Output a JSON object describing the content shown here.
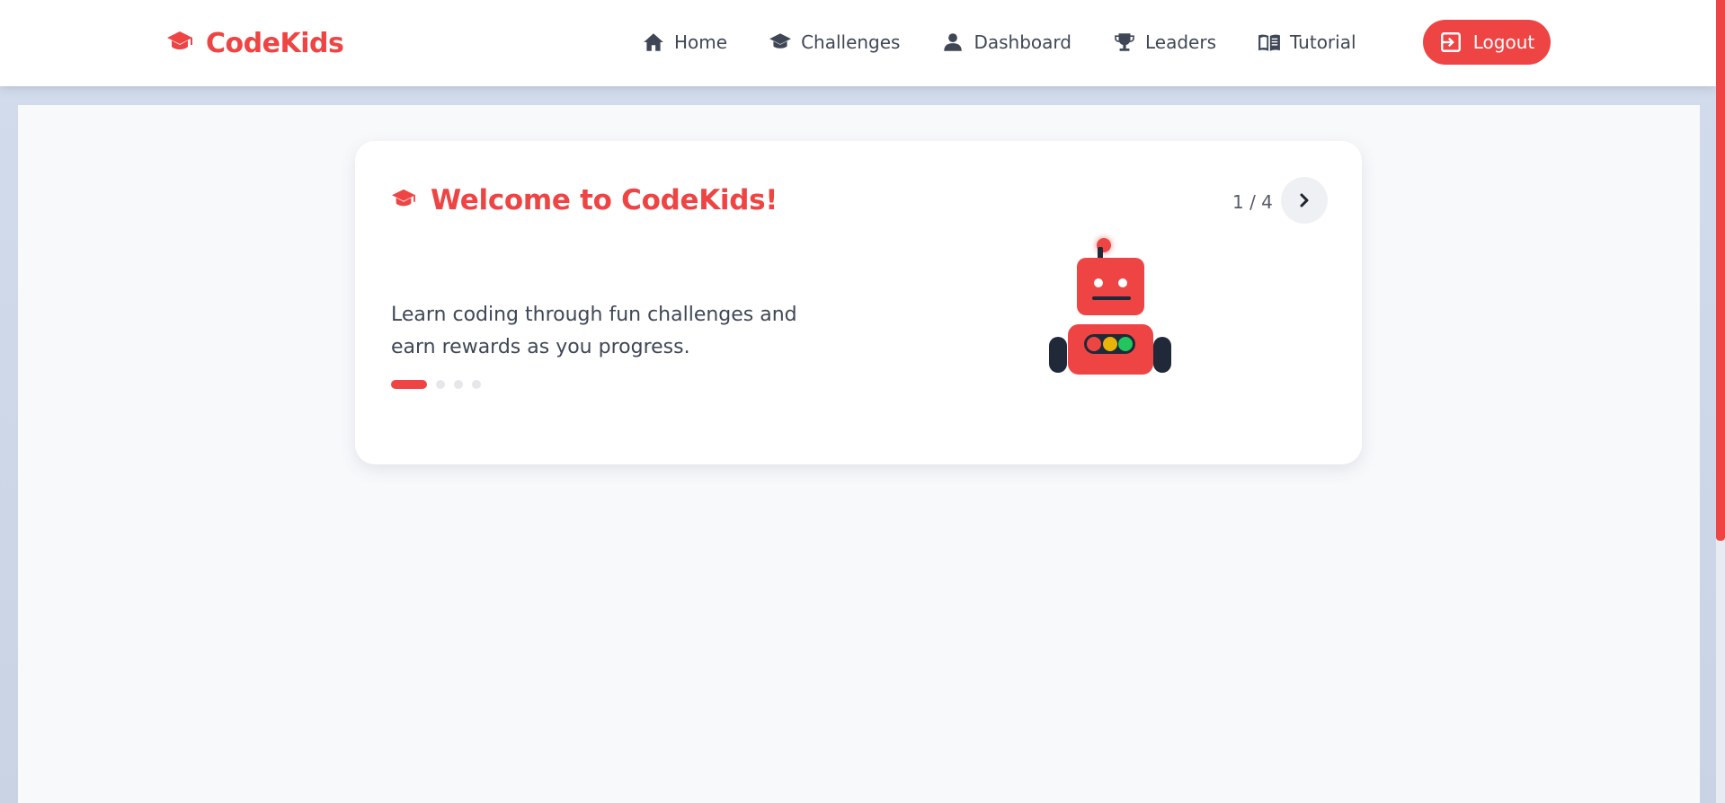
{
  "brand": {
    "name": "CodeKids",
    "icon": "graduation-cap-icon",
    "color": "#ef4444"
  },
  "nav": {
    "items": [
      {
        "label": "Home",
        "icon": "home-icon"
      },
      {
        "label": "Challenges",
        "icon": "graduation-cap-icon"
      },
      {
        "label": "Dashboard",
        "icon": "user-icon"
      },
      {
        "label": "Leaders",
        "icon": "trophy-icon"
      },
      {
        "label": "Tutorial",
        "icon": "book-icon"
      }
    ],
    "logout_label": "Logout",
    "logout_icon": "logout-icon"
  },
  "card": {
    "title": "Welcome to CodeKids!",
    "title_icon": "graduation-cap-icon",
    "counter": "1 / 4",
    "description": "Learn coding through fun challenges and earn rewards as you progress.",
    "slide_current": 1,
    "slide_total": 4,
    "illustration": "robot-icon"
  },
  "colors": {
    "accent": "#ef4444",
    "text": "#3f4756",
    "robot_dark": "#1f2937",
    "light_yellow": "#eab308",
    "light_green": "#22c55e"
  }
}
